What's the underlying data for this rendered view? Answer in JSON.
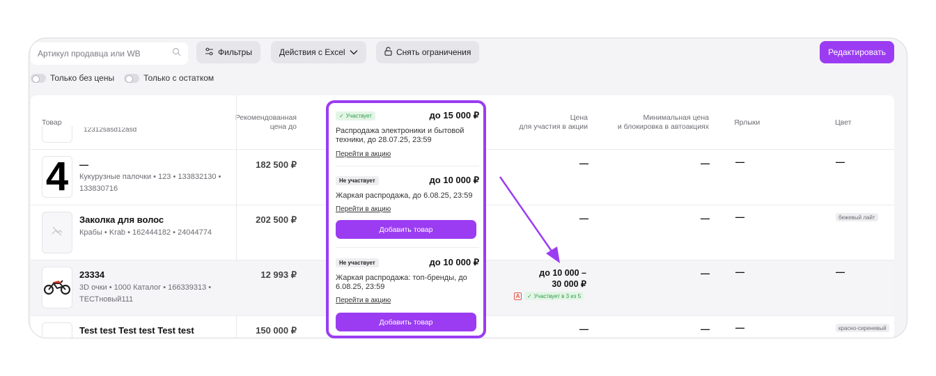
{
  "toolbar": {
    "search_placeholder": "Артикул продавца или WB",
    "filters_label": "Фильтры",
    "excel_label": "Действия с Excel",
    "unlock_label": "Снять ограничения",
    "edit_label": "Редактировать"
  },
  "toggles": {
    "no_price": "Только без цены",
    "in_stock": "Только с остатком"
  },
  "table": {
    "headers": {
      "product": "Товар",
      "recommended": "Рекомендованная\nцена до",
      "price": "Цена\nдля участия в акции",
      "min_price": "Минимальная цена\nи блокировка в автоакциях",
      "labels": "Ярлыки",
      "color": "Цвет"
    },
    "partial_top_meta": "12312sasd12asd",
    "rows": [
      {
        "name": "—",
        "meta": "Кукурузные палочки • 123 • 133832130 • 133830716",
        "rec_price": "182 500 ₽",
        "price": "—",
        "min_price": "—",
        "labels": "—",
        "color": "—",
        "thumb": "4"
      },
      {
        "name": "Заколка для волос",
        "meta": "Крабы • Krab • 162444182 • 24044774",
        "rec_price": "202 500 ₽",
        "price": "—",
        "min_price": "—",
        "labels": "—",
        "color": "бежевый лайт"
      },
      {
        "name": "23334",
        "meta": "3D очки • 1000 Каталог • 166339313 • ТЕСТновый111",
        "rec_price": "12 993 ₽",
        "price": "до 10 000 –\n30 000 ₽",
        "badge_a": "A",
        "badge_status": "Участвует в 3 из 5",
        "min_price": "—",
        "labels": "—",
        "color": "—"
      },
      {
        "name": "Test test Test test Test test",
        "rec_price": "150 000 ₽",
        "price": "—",
        "min_price": "—",
        "labels": "—",
        "color": "красно-сиреневый"
      }
    ]
  },
  "promo_popup": {
    "cards": [
      {
        "status": "Участвует",
        "amount": "до 15 000 ₽",
        "desc": "Распродажа электроники и бытовой техники, до 28.07.25, 23:59",
        "link": "Перейти в акцию"
      },
      {
        "status": "Не участвует",
        "amount": "до 10 000 ₽",
        "desc": "Жаркая распродажа, до 6.08.25, 23:59",
        "link": "Перейти в акцию",
        "button": "Добавить товар"
      },
      {
        "status": "Не участвует",
        "amount": "до 10 000 ₽",
        "desc": "Жаркая распродажа: топ-бренды, до 6.08.25, 23:59",
        "link": "Перейти в акцию",
        "button": "Добавить товар"
      }
    ]
  },
  "colors": {
    "accent": "#9b3cf2",
    "success": "#2e9b48",
    "warning": "#e2574c"
  }
}
